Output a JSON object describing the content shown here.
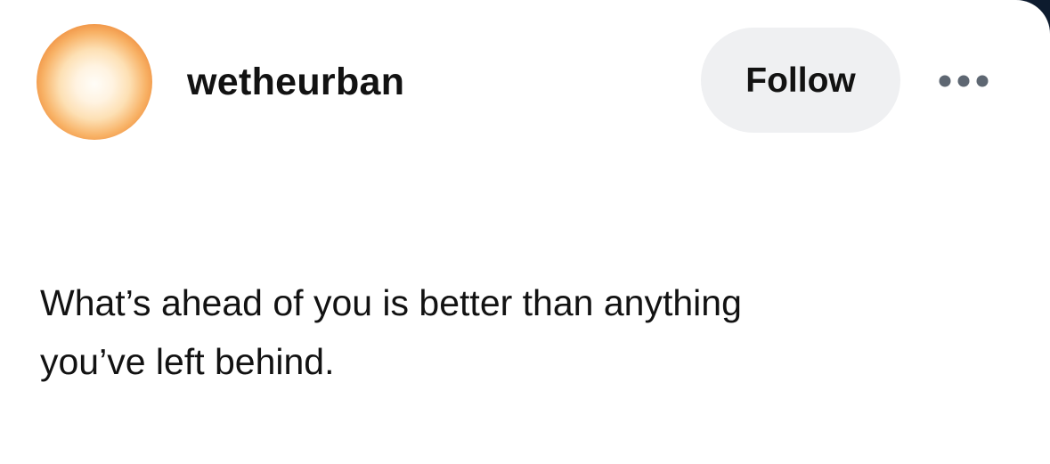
{
  "post": {
    "author": {
      "username": "wetheurban",
      "avatar_icon": "sun-gradient-avatar",
      "avatar_colors": [
        "#fffdf8",
        "#fde0b4",
        "#f8b266",
        "#e0692a",
        "#c9501f"
      ]
    },
    "follow_label": "Follow",
    "more_icon": "more-dots-icon",
    "text_lines": [
      "What’s ahead of you is better than anything",
      "you’ve left behind."
    ]
  },
  "colors": {
    "card_background": "#ffffff",
    "button_background": "#eff0f2",
    "text": "#121212",
    "dots": "#5e6772",
    "frame_edge": "#0d1b2e"
  }
}
